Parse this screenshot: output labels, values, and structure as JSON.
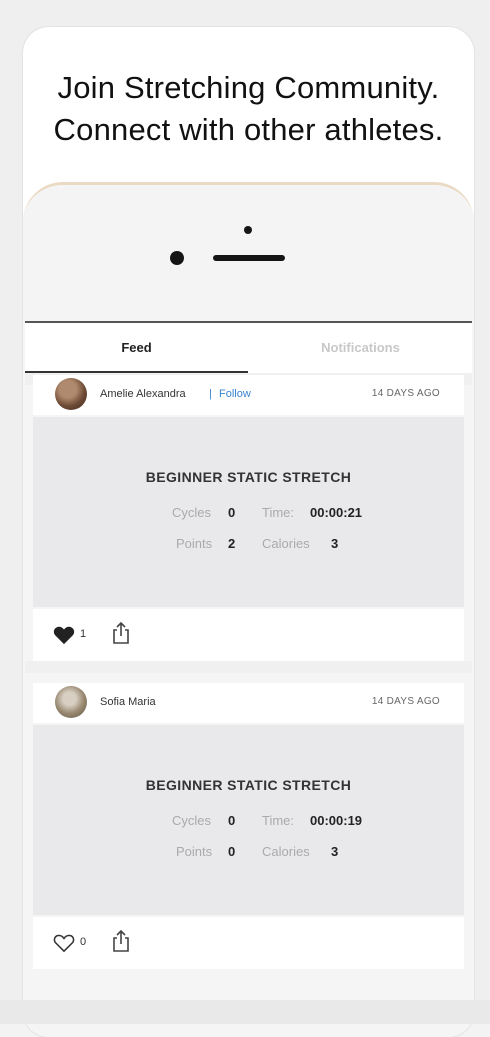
{
  "headline": {
    "line1": "Join Stretching Community.",
    "line2": "Connect with other athletes."
  },
  "tabs": [
    {
      "label": "Feed",
      "active": true
    },
    {
      "label": "Notifications",
      "active": false
    }
  ],
  "posts": [
    {
      "user": "Amelie Alexandra",
      "separator": "|",
      "follow_label": "Follow",
      "time": "14 DAYS AGO",
      "workout": "BEGINNER STATIC STRETCH",
      "stats": {
        "cycles_label": "Cycles",
        "cycles": "0",
        "time_label": "Time:",
        "time": "00:00:21",
        "points_label": "Points",
        "points": "2",
        "calories_label": "Calories",
        "calories": "3"
      },
      "likes": "1",
      "liked": true
    },
    {
      "user": "Sofia Maria",
      "time": "14 DAYS AGO",
      "workout": "BEGINNER STATIC STRETCH",
      "stats": {
        "cycles_label": "Cycles",
        "cycles": "0",
        "time_label": "Time:",
        "time": "00:00:19",
        "points_label": "Points",
        "points": "0",
        "calories_label": "Calories",
        "calories": "3"
      },
      "likes": "0",
      "liked": false
    }
  ],
  "colors": {
    "accent_link": "#3a86d1",
    "phone_rim": "#ead9c3"
  }
}
